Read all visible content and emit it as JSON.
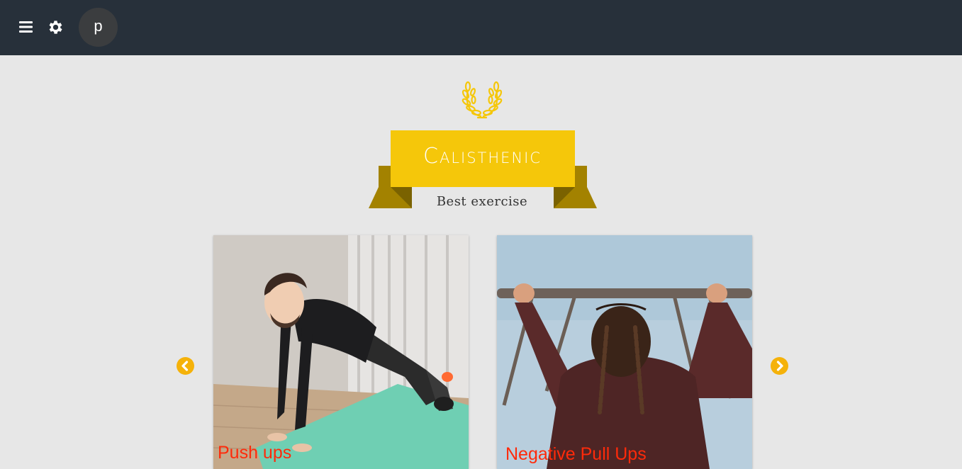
{
  "header": {
    "menu_icon": "hamburger-menu-icon",
    "settings_icon": "gear-icon",
    "avatar_letter": "p",
    "colors": {
      "background": "#27303a",
      "avatar": "#3b3d3f"
    }
  },
  "hero": {
    "emblem_icon": "laurel-wreath-icon",
    "title": "Calisthenic",
    "subtitle": "Best exercise",
    "colors": {
      "ribbon_front": "#f5c70a",
      "ribbon_back": "#a38200",
      "emblem": "#f5c70a"
    }
  },
  "carousel": {
    "prev_icon": "chevron-left-circle-icon",
    "next_icon": "chevron-right-circle-icon",
    "arrow_color": "#f5b20a",
    "cards": [
      {
        "title": "Push ups",
        "image": "man doing push ups on mat"
      },
      {
        "title": "Negative Pull Ups",
        "image": "woman hanging on pull-up bar"
      }
    ],
    "title_color": "#ff2a0a"
  }
}
